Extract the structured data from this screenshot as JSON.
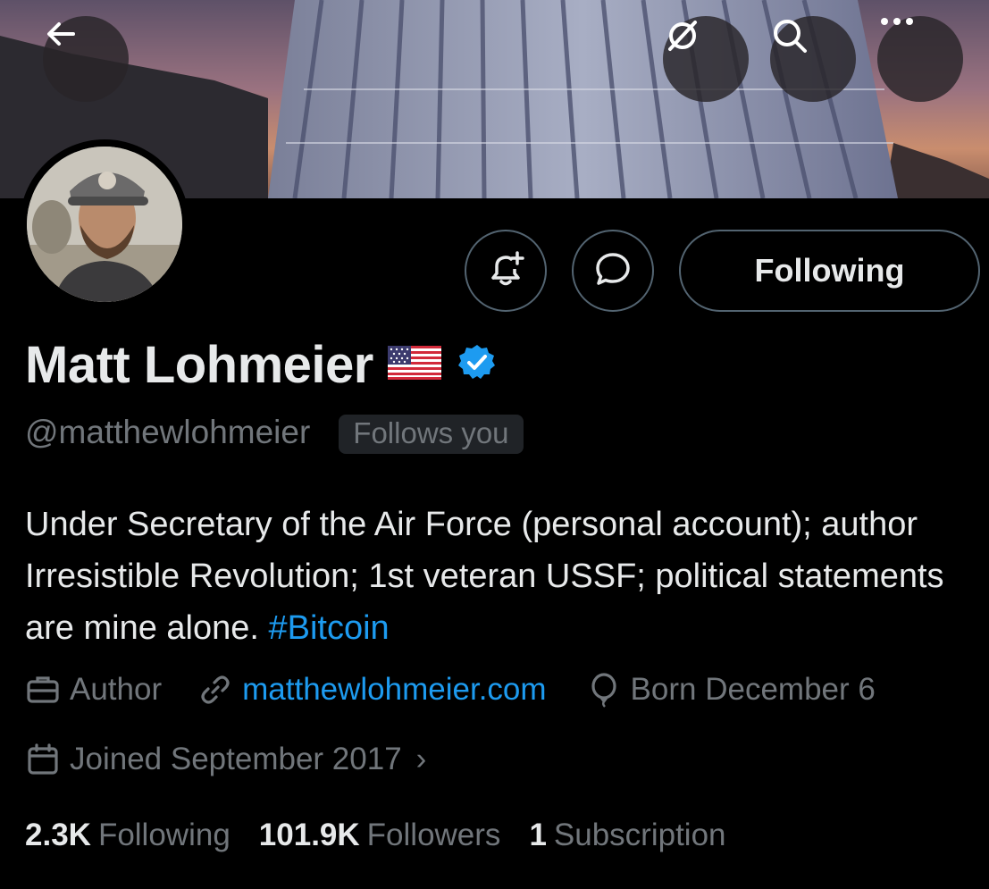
{
  "header": {
    "back_icon": "arrow-left-icon",
    "grok_icon": "grok-icon",
    "search_icon": "search-icon",
    "more_icon": "more-horizontal-icon"
  },
  "profile": {
    "display_name": "Matt Lohmeier",
    "flag_emoji": "us-flag-icon",
    "verified": true,
    "handle": "@matthewlohmeier",
    "follows_you": "Follows you",
    "bio_text": "Under Secretary of the Air Force (personal account); author Irresistible Revolution; 1st veteran USSF; political statements are mine alone. ",
    "bio_hashtag": "#Bitcoin",
    "profession": "Author",
    "website": "matthewlohmeier.com",
    "birthday": "Born December 6",
    "joined": "Joined September 2017",
    "joined_chevron": "›"
  },
  "actions": {
    "notify_icon": "bell-plus-icon",
    "message_icon": "message-bubble-icon",
    "following_label": "Following"
  },
  "stats": {
    "following_count": "2.3K",
    "following_label": "Following",
    "followers_count": "101.9K",
    "followers_label": "Followers",
    "subscription_count": "1",
    "subscription_label": "Subscription"
  },
  "colors": {
    "accent": "#1d9bf0",
    "muted": "#71767b",
    "text": "#e7e9ea",
    "background": "#000000"
  }
}
